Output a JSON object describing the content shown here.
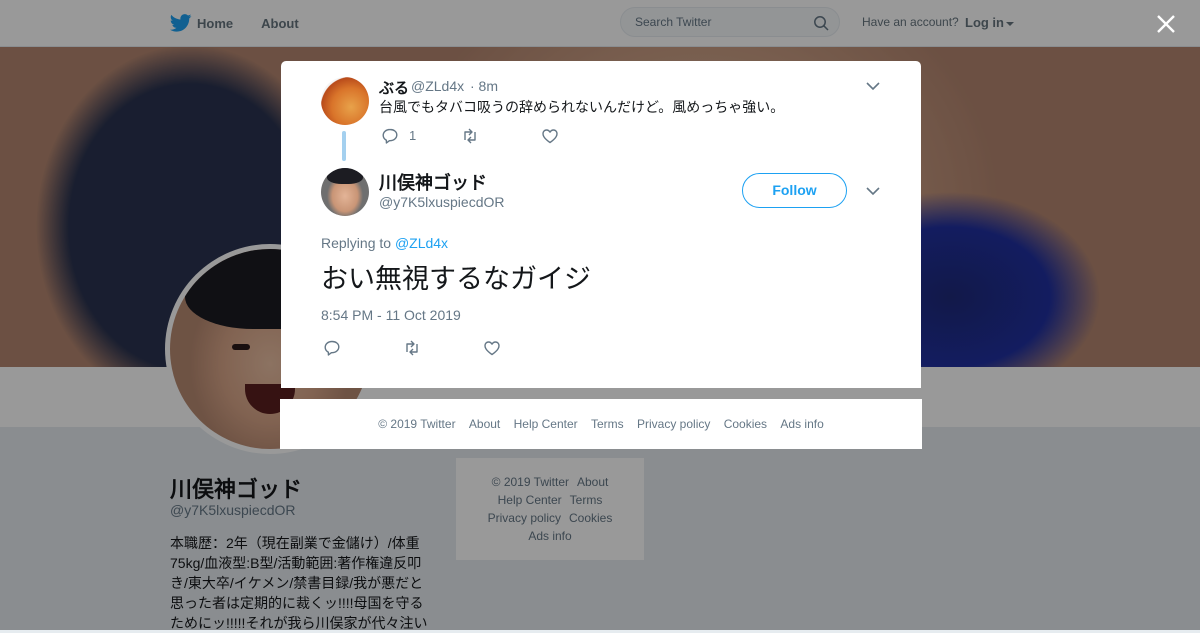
{
  "colors": {
    "accent": "#1da1f2",
    "muted": "#657786",
    "text": "#14171a",
    "thread_line": "#a4d0ef"
  },
  "topbar": {
    "logo_icon": "twitter-bird-icon",
    "home_label": "Home",
    "about_label": "About",
    "search_placeholder": "Search Twitter",
    "account_prompt": "Have an account?",
    "login_label": "Log in"
  },
  "profile": {
    "name": "川俣神ゴッド",
    "handle": "@y7K5lxuspiecdOR",
    "bio": "本職歴：2年（現在副業で金儲け）/体重75kg/血液型:B型/活動範囲:著作権違反叩き/東大卒/イケメン/禁書目録/我が悪だと思った者は定期的に裁くッ!!!!母国を守るためにッ!!!!!それが我ら川俣家が代々注い"
  },
  "side_footer": {
    "items": [
      "© 2019 Twitter",
      "About",
      "Help Center",
      "Terms",
      "Privacy policy",
      "Cookies",
      "Ads info"
    ]
  },
  "modal": {
    "parent_tweet": {
      "name": "ぶる",
      "handle": "@ZLd4x",
      "time": "· 8m",
      "text": "台風でもタバコ吸うの辞められないんだけど。風めっちゃ強い。",
      "reply_count": "1"
    },
    "main_tweet": {
      "name": "川俣神ゴッド",
      "handle": "@y7K5lxuspiecdOR",
      "follow_label": "Follow",
      "replying_to_label": "Replying to",
      "replying_to_handle": "@ZLd4x",
      "text": "おい無視するなガイジ",
      "timestamp": "8:54 PM - 11 Oct 2019"
    },
    "footer": {
      "items": [
        "© 2019 Twitter",
        "About",
        "Help Center",
        "Terms",
        "Privacy policy",
        "Cookies",
        "Ads info"
      ]
    }
  }
}
